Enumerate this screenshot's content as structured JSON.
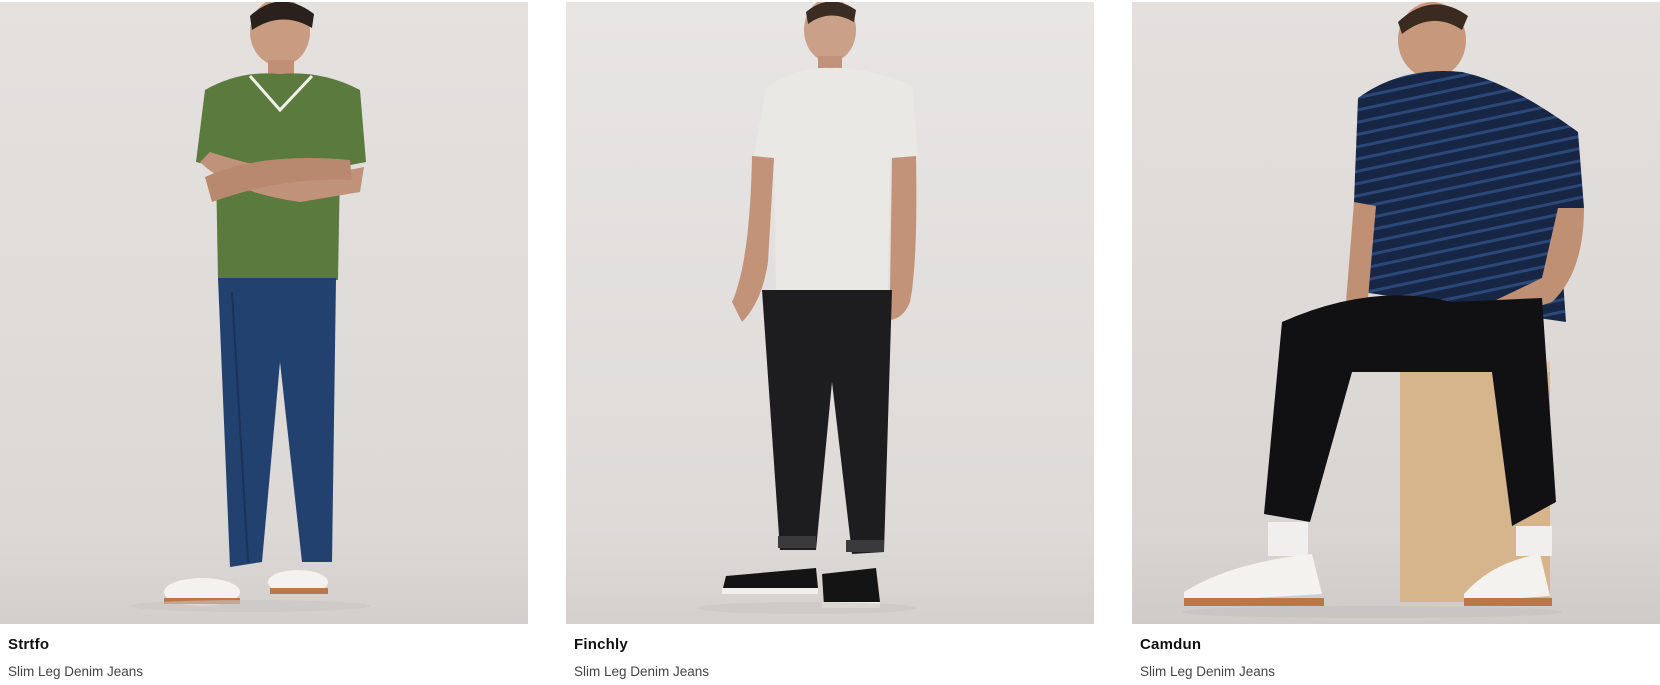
{
  "products": [
    {
      "name": "Strtfo",
      "subtitle": "Slim Leg Denim Jeans",
      "shirt_color": "#5b7a3e",
      "jeans_color": "#23416e",
      "shoe_color": "#f4f2ee"
    },
    {
      "name": "Finchly",
      "subtitle": "Slim Leg Denim Jeans",
      "shirt_color": "#e9e8e5",
      "jeans_color": "#1d1d1f",
      "shoe_color": "#141414"
    },
    {
      "name": "Camdun",
      "subtitle": "Slim Leg Denim Jeans",
      "shirt_color": "#162644",
      "jeans_color": "#111113",
      "shoe_color": "#f4f2ee"
    }
  ]
}
